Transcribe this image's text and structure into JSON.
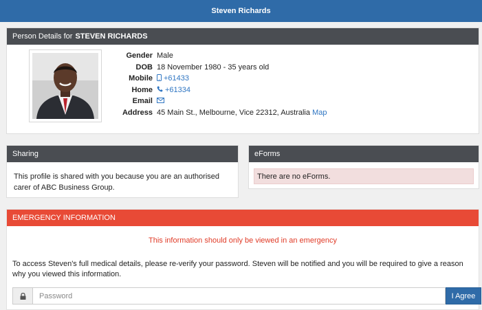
{
  "header": {
    "title": "Steven Richards"
  },
  "person": {
    "heading_prefix": "Person Details for",
    "heading_name": "STEVEN RICHARDS",
    "fields": {
      "gender_label": "Gender",
      "gender": "Male",
      "dob_label": "DOB",
      "dob": "18 November 1980 - 35 years old",
      "mobile_label": "Mobile",
      "mobile": "+61433",
      "home_label": "Home",
      "home": "+61334",
      "email_label": "Email",
      "address_label": "Address",
      "address": "45 Main St., Melbourne, Vice 22312, Australia",
      "map_link": "Map"
    }
  },
  "sharing": {
    "title": "Sharing",
    "text": "This profile is shared with you because you are an authorised carer of ABC Business Group."
  },
  "eforms": {
    "title": "eForms",
    "empty_text": "There are no eForms."
  },
  "emergency": {
    "title": "EMERGENCY INFORMATION",
    "warning": "This information should only be viewed in an emergency",
    "info": "To access Steven's full medical details, please re-verify your password. Steven will be notified and you will be required to give a reason why you viewed this information.",
    "password_placeholder": "Password",
    "agree_label": "I Agree"
  },
  "colors": {
    "primary": "#2f6ba8",
    "panel_header": "#4a4d52",
    "emergency": "#e84a36",
    "link": "#2e75c2",
    "alert_bg": "#f2dede"
  },
  "icons": {
    "mobile": "mobile-icon",
    "home": "phone-icon",
    "email": "envelope-icon",
    "lock": "lock-icon"
  }
}
